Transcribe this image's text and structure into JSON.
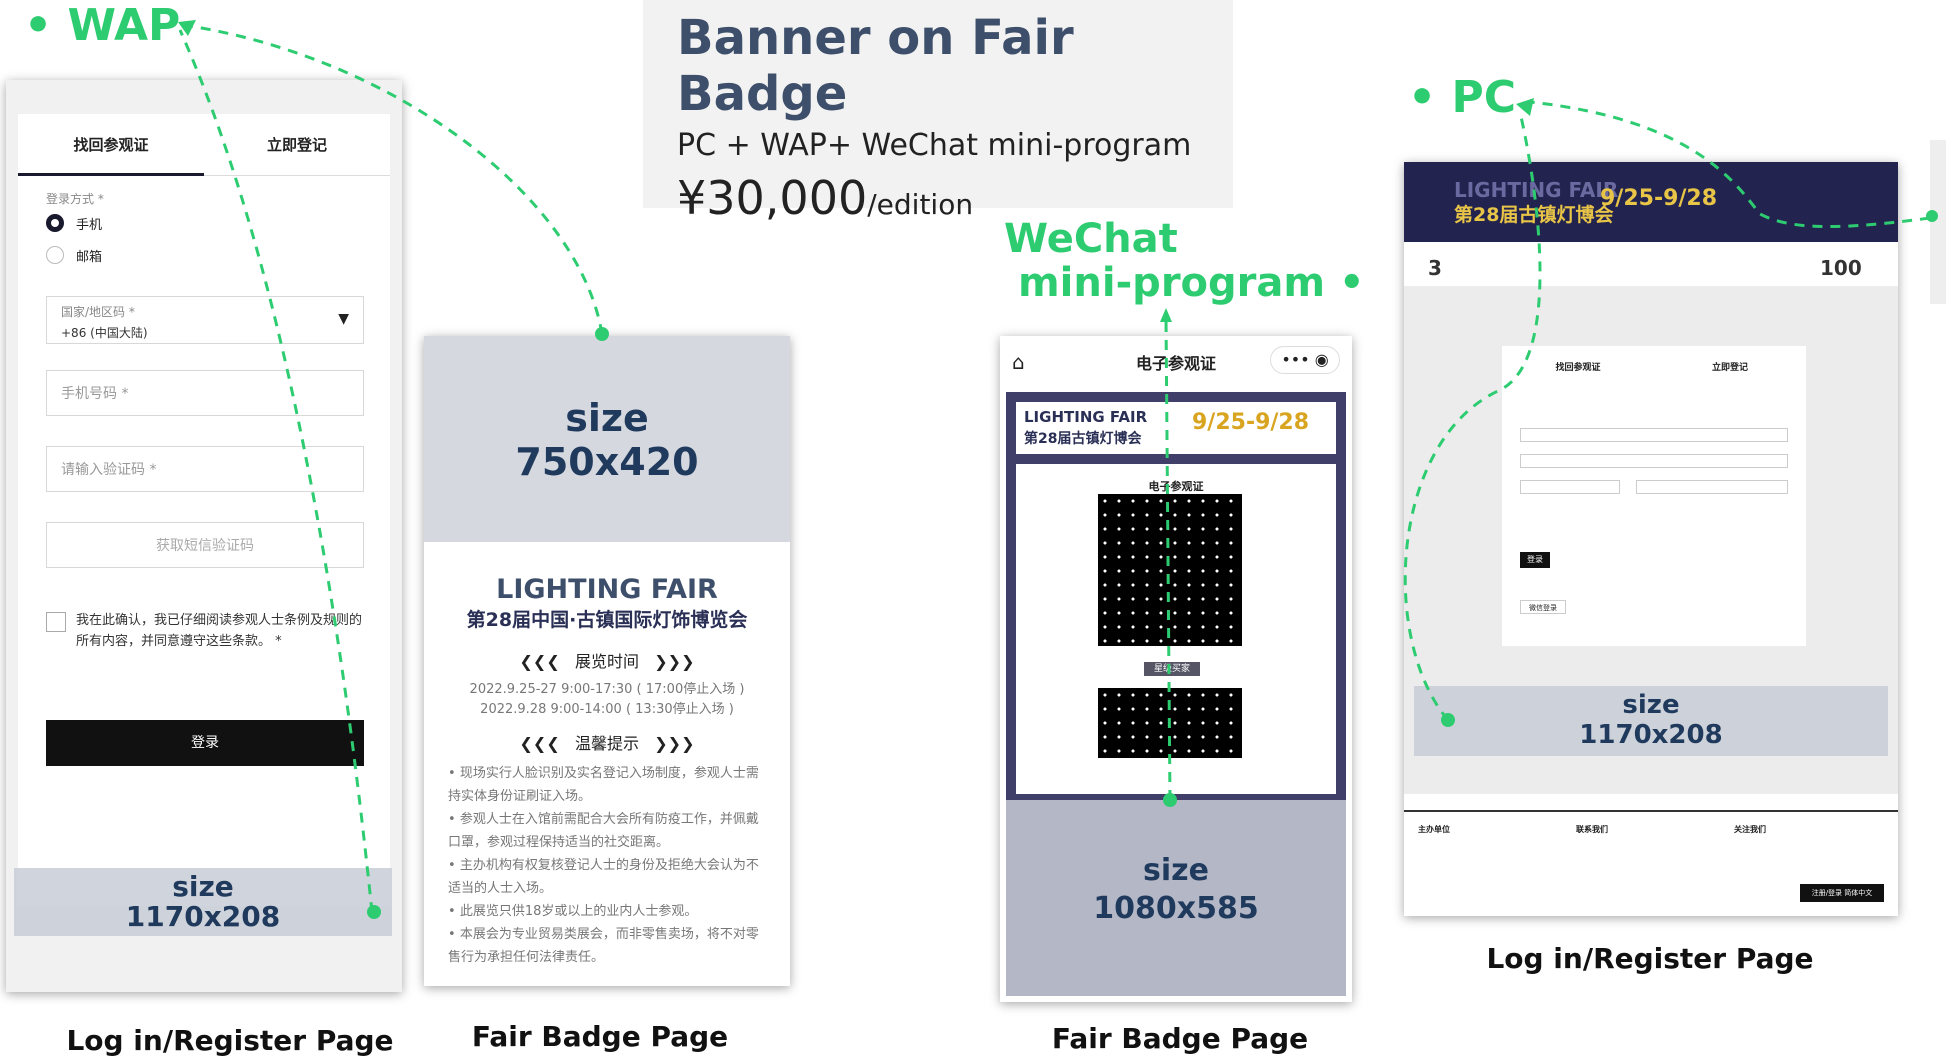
{
  "header": {
    "title": "Banner on Fair Badge",
    "platforms": "PC + WAP+ WeChat mini-program",
    "price": "¥30,000",
    "price_unit": "/edition"
  },
  "sections": {
    "wap": "• WAP",
    "pc": "• PC",
    "wechat_line1": "WeChat",
    "wechat_line2": "mini-program •"
  },
  "captions": {
    "wap_login": "Log in/Register Page",
    "wap_badge": "Fair Badge Page",
    "wechat_badge": "Fair Badge Page",
    "pc_login": "Log in/Register Page"
  },
  "sizes": {
    "label": "size",
    "wap_login": "1170x208",
    "wap_badge": "750x420",
    "wechat": "1080x585",
    "pc": "1170x208"
  },
  "wap_login": {
    "tab_recover": "找回参观证",
    "tab_register": "立即登记",
    "login_method": "登录方式 *",
    "opt_phone": "手机",
    "opt_email": "邮箱",
    "region_label": "国家/地区码 *",
    "region_value": "+86 (中国大陆)",
    "phone_placeholder": "手机号码 *",
    "code_placeholder": "请输入验证码 *",
    "get_code": "获取短信验证码",
    "agree_text": "我在此确认，我已仔细阅读参观人士条例及规则的所有内容，并同意遵守这些条款。 *",
    "login_button": "登录"
  },
  "badge_page": {
    "fair_en": "LIGHTING FAIR",
    "fair_cn": "第28届中国·古镇国际灯饰博览会",
    "time_heading": "展览时间",
    "time_rows": [
      "2022.9.25-27    9:00-17:30 ( 17:00停止入场 )",
      "2022.9.28        9:00-14:00 ( 13:30停止入场 )"
    ],
    "tips_heading": "温馨提示",
    "tips": [
      "现场实行人脸识别及实名登记入场制度，参观人士需持实体身份证刷证入场。",
      "参观人士在入馆前需配合大会所有防疫工作，并佩戴口罩，参观过程保持适当的社交距离。",
      "主办机构有权复核登记人士的身份及拒绝大会认为不适当的人士入场。",
      "此展览只供18岁或以上的业内人士参观。",
      "本展会为专业贸易类展会，而非零售卖场，将不对零售行为承担任何法律责任。"
    ]
  },
  "wechat": {
    "title": "电子参观证",
    "fair_en": "LIGHTING FAIR",
    "fair_cn": "第28届古镇灯博会",
    "dates": "9/25-9/28",
    "badge_label": "电子参观证",
    "role_tag": "星级买家"
  },
  "pc": {
    "fair_en": "LIGHTING FAIR",
    "fair_cn": "第28届古镇灯博会",
    "dates": "9/25-9/28",
    "countdown": "3",
    "count_visitors": "100",
    "tab_recover": "找回参观证",
    "tab_register": "立即登记",
    "login_button": "登录",
    "wechat_login": "微信登录",
    "footer_cols": [
      "主办单位",
      "联系我们",
      "关注我们"
    ],
    "footer_btn1": "注册/登录",
    "footer_btn2": "简体中文"
  },
  "colors": {
    "accent": "#2ecc71",
    "title_blue": "#3d4f6a",
    "navy": "#23234f"
  }
}
